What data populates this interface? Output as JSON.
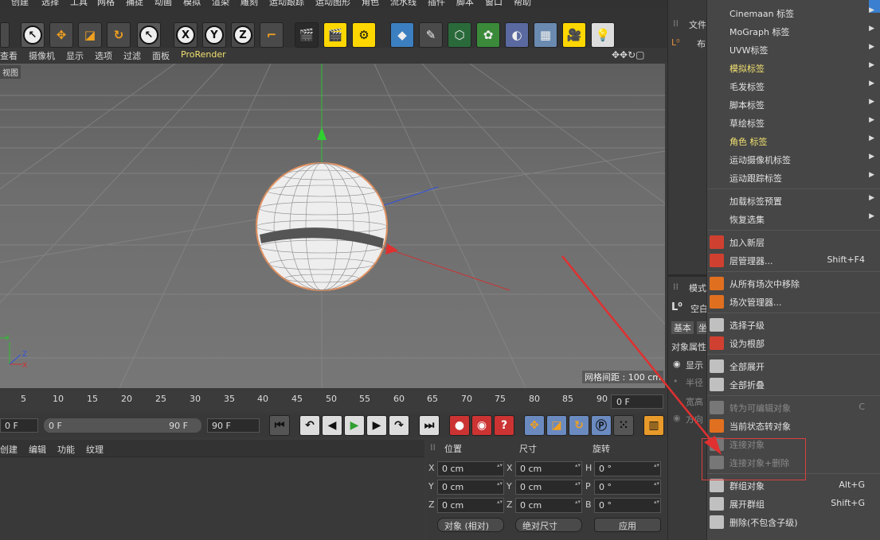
{
  "menubar": [
    "创建",
    "选择",
    "工具",
    "网格",
    "捕捉",
    "动画",
    "模拟",
    "渲染",
    "雕刻",
    "运动跟踪",
    "运动图形",
    "角色",
    "流水线",
    "插件",
    "脚本",
    "窗口",
    "帮助"
  ],
  "viewport_menu": [
    "查看",
    "摄像机",
    "显示",
    "选项",
    "过滤",
    "面板",
    "ProRender"
  ],
  "viewport": {
    "label": "视图",
    "grid_spacing": "网格间距 : 100 cm"
  },
  "timeline": {
    "ticks": [
      "5",
      "10",
      "15",
      "20",
      "25",
      "30",
      "35",
      "40",
      "45",
      "50",
      "55",
      "60",
      "65",
      "70",
      "75",
      "80",
      "85",
      "90"
    ],
    "current_frame": "0 F"
  },
  "playback": {
    "start": "0 F",
    "range_start": "0 F",
    "range_end": "90 F",
    "end": "90 F"
  },
  "material_tabs": [
    "创建",
    "编辑",
    "功能",
    "纹理"
  ],
  "coords": {
    "headers": {
      "position": "位置",
      "size": "尺寸",
      "rotation": "旋转"
    },
    "rows": [
      {
        "axis": "X",
        "pos": "0 cm",
        "size_axis": "X",
        "size": "0 cm",
        "rot_axis": "H",
        "rot": "0 °"
      },
      {
        "axis": "Y",
        "pos": "0 cm",
        "size_axis": "Y",
        "size": "0 cm",
        "rot_axis": "P",
        "rot": "0 °"
      },
      {
        "axis": "Z",
        "pos": "0 cm",
        "size_axis": "Z",
        "size": "0 cm",
        "rot_axis": "B",
        "rot": "0 °"
      }
    ],
    "mode": "对象 (相对)",
    "size_mode": "绝对尺寸",
    "apply": "应用"
  },
  "right_panel": {
    "files_tab": "文件",
    "object_item": "布",
    "attr_tab": "模式",
    "object_name": "空白",
    "tabs": [
      "基本",
      "坐"
    ],
    "attr_title": "对象属性",
    "options": [
      "显示",
      "半径",
      "宽高",
      "方向"
    ]
  },
  "context_menu": [
    {
      "label": "Cinemaan 标签",
      "arrow": true
    },
    {
      "label": "MoGraph 标签",
      "arrow": true
    },
    {
      "label": "UVW标签",
      "arrow": true
    },
    {
      "label": "模拟标签",
      "arrow": true,
      "style": "y"
    },
    {
      "label": "毛发标签",
      "arrow": true
    },
    {
      "label": "脚本标签",
      "arrow": true
    },
    {
      "label": "草绘标签",
      "arrow": true
    },
    {
      "label": "角色 标签",
      "arrow": true,
      "style": "y"
    },
    {
      "label": "运动摄像机标签",
      "arrow": true
    },
    {
      "label": "运动跟踪标签",
      "arrow": true
    },
    {
      "sep": true
    },
    {
      "label": "加载标签预置",
      "arrow": true
    },
    {
      "label": "恢复选集",
      "arrow": true
    },
    {
      "sep": true
    },
    {
      "label": "加入新层",
      "icon": "#d04030"
    },
    {
      "label": "层管理器...",
      "icon": "#d04030",
      "shortcut": "Shift+F4"
    },
    {
      "sep": true
    },
    {
      "label": "从所有场次中移除",
      "icon": "#e07020"
    },
    {
      "label": "场次管理器...",
      "icon": "#e07020"
    },
    {
      "sep": true
    },
    {
      "label": "选择子级",
      "icon": "#c0c0c0"
    },
    {
      "label": "设为根部",
      "icon": "#d04030"
    },
    {
      "sep": true
    },
    {
      "label": "全部展开",
      "icon": "#c0c0c0"
    },
    {
      "label": "全部折叠",
      "icon": "#c0c0c0"
    },
    {
      "sep": true
    },
    {
      "label": "转为可编辑对象",
      "icon": "#777777",
      "shortcut": "C",
      "style": "d"
    },
    {
      "label": "当前状态转对象",
      "icon": "#e07020"
    },
    {
      "label": "连接对象",
      "icon": "#777777",
      "style": "d"
    },
    {
      "label": "连接对象+删除",
      "icon": "#777777",
      "style": "d"
    },
    {
      "sep": true
    },
    {
      "label": "群组对象",
      "icon": "#c0c0c0",
      "shortcut": "Alt+G"
    },
    {
      "label": "展开群组",
      "icon": "#c0c0c0",
      "shortcut": "Shift+G"
    },
    {
      "label": "删除(不包含子级)",
      "icon": "#c0c0c0"
    }
  ],
  "colors": {
    "accent": "#ffd700",
    "annotation": "#e03030"
  }
}
